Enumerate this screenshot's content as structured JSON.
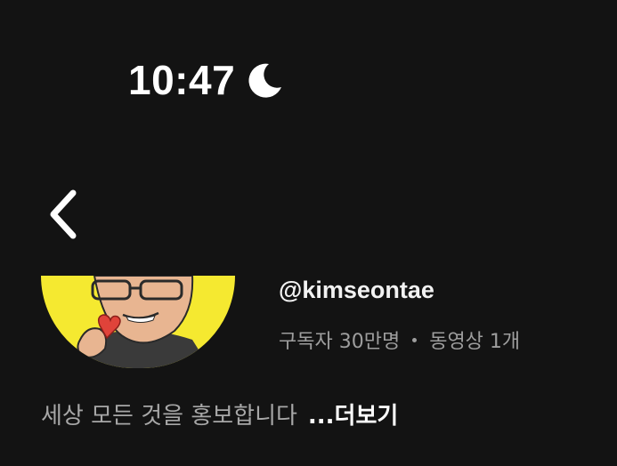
{
  "status_bar": {
    "time": "10:47",
    "focus_icon": "moon-icon"
  },
  "nav": {
    "back_icon": "chevron-left-icon"
  },
  "channel": {
    "avatar_icon": "cartoon-avatar",
    "handle": "@kimseontae",
    "subscribers": "구독자 30만명",
    "videos": "동영상 1개",
    "description": "세상 모든 것을 홍보합니다",
    "more_label": "...더보기"
  },
  "colors": {
    "background": "#131313",
    "avatar_bg": "#f5e930",
    "primary_text": "#ffffff",
    "secondary_text": "#9e9e9e"
  }
}
